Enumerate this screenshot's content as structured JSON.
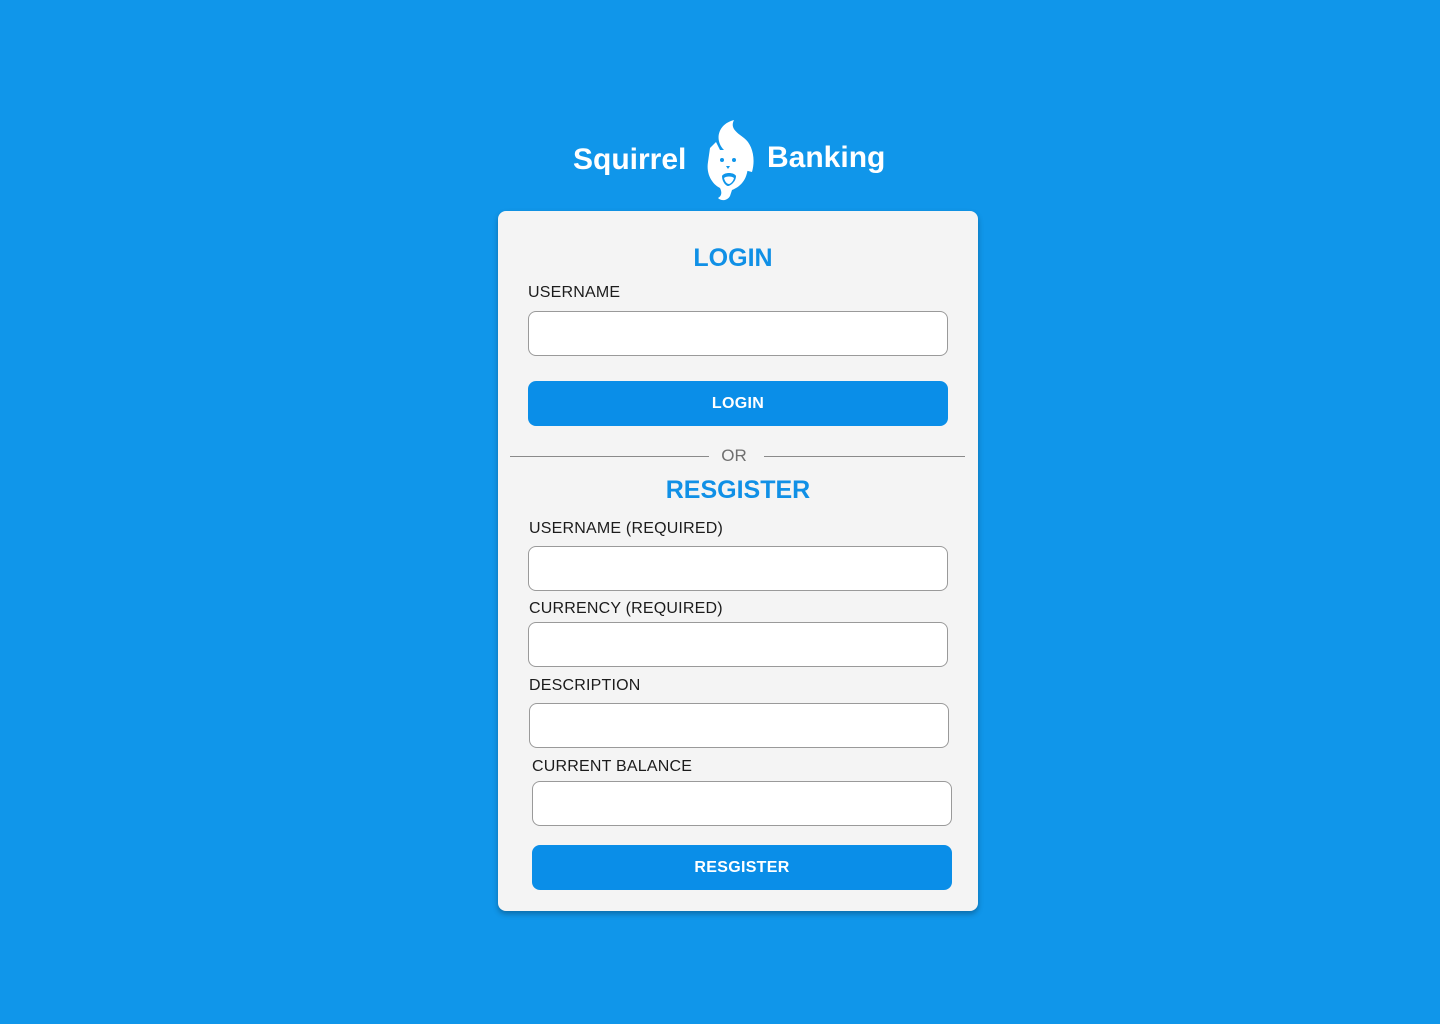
{
  "brand": {
    "name_left": "Squirrel",
    "name_right": "Banking",
    "logo_icon": "squirrel-icon"
  },
  "login": {
    "title": "LOGIN",
    "username_label": "USERNAME",
    "username_value": "",
    "button_label": "LOGIN"
  },
  "divider": {
    "text": "OR"
  },
  "register": {
    "title": "RESGISTER",
    "username_label": "USERNAME (REQUIRED)",
    "currency_label": "CURRENCY (REQUIRED)",
    "description_label": "DESCRIPTION",
    "balance_label": "CURRENT BALANCE",
    "button_label": "RESGISTER"
  },
  "colors": {
    "background": "#1096EA",
    "card": "#F4F4F4",
    "accent": "#0A8EE8",
    "title": "#1090E6"
  }
}
